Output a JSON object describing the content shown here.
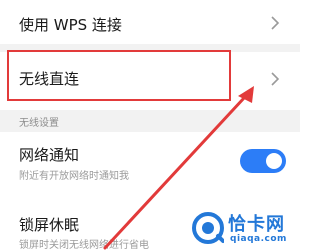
{
  "settings": {
    "wps_connect": {
      "title": "使用 WPS 连接"
    },
    "wifi_direct": {
      "title": "无线直连"
    },
    "section_wireless_settings": "无线设置",
    "network_notification": {
      "title": "网络通知",
      "subtitle": "附近有开放网络时通知我",
      "enabled": true
    },
    "screen_lock_sleep": {
      "title": "锁屏休眠",
      "subtitle": "锁屏时关闭无线网络进行省电"
    }
  },
  "annotation": {
    "highlight_color": "#e23a3a",
    "arrow_color": "#e23a3a"
  },
  "watermark": {
    "name": "恰卡网",
    "domain": "qiaqa.com",
    "color": "#2378d8"
  },
  "colors": {
    "toggle_on": "#2c7df7",
    "section_bg": "#f2f2f2"
  }
}
